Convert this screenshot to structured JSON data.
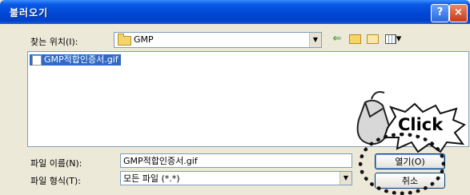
{
  "dialog": {
    "title": "불러오기",
    "help_icon": "help-icon",
    "help_glyph": "?",
    "close_icon": "close-icon",
    "close_glyph": "×"
  },
  "lookin": {
    "label": "찾는 위치(I):",
    "value": "GMP",
    "dropdown_glyph": "▼"
  },
  "toolbar": {
    "back_icon": "back-arrow-icon",
    "back_glyph": "⇐",
    "up_icon": "up-folder-icon",
    "new_folder_icon": "new-folder-icon",
    "views_icon": "views-menu-icon",
    "views_caret": "▾"
  },
  "file_list": {
    "items": [
      {
        "name": "GMP적합인증서.gif",
        "selected": true,
        "icon": "image-file-icon"
      }
    ]
  },
  "file_name": {
    "label": "파일 이름(N):",
    "value": "GMP적합인증서.gif"
  },
  "file_type": {
    "label": "파일 형식(T):",
    "value": "모든 파일 (*.*)",
    "dropdown_glyph": "▼"
  },
  "buttons": {
    "open": "열기(O)",
    "cancel": "취소"
  },
  "annotation": {
    "text": "Click",
    "mouse_icon": "mouse-icon"
  },
  "colors": {
    "titlebar": "#0047D5",
    "selection": "#316AC5",
    "dialog_bg": "#ECE9D8"
  }
}
